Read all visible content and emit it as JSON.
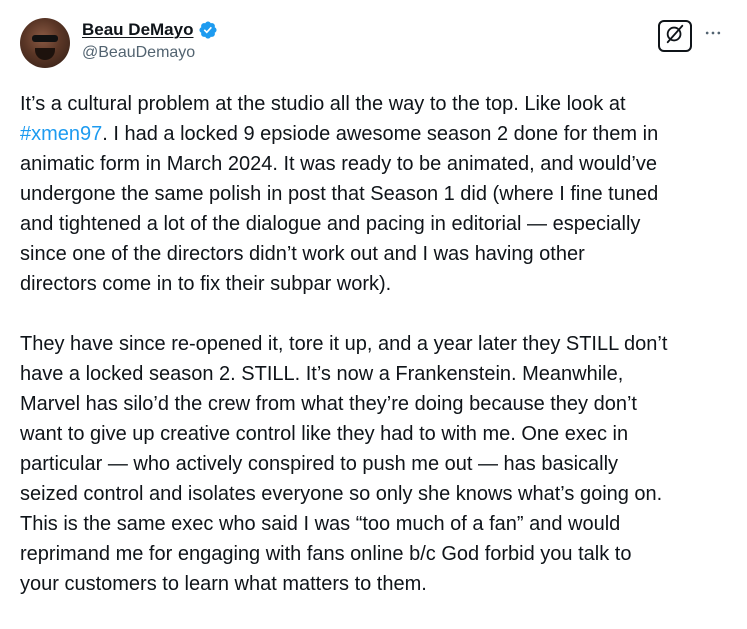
{
  "author": {
    "display_name": "Beau DeMayo",
    "handle": "@BeauDemayo",
    "verified": true,
    "verified_color": "#1d9bf0"
  },
  "actions": {
    "grok_icon": "grok-icon",
    "more_icon": "more-icon"
  },
  "tweet": {
    "hashtag_color": "#1d9bf0",
    "paragraph1": {
      "pre_hashtag": "It’s a cultural problem at the studio all the way to the top. Like look at",
      "hashtag": "#xmen97",
      "lines": [
        ". I had a locked 9 epsiode awesome season 2 done for them in",
        "animatic form in March 2024. It was ready to be animated, and would’ve",
        "undergone the same polish in post that  Season 1 did (where I fine tuned",
        "and tightened a lot of the dialogue and pacing in editorial — especially",
        "since one of the directors didn’t work out and I was having other",
        "directors come in to fix their subpar work)."
      ]
    },
    "paragraph2": {
      "lines": [
        "They have since re-opened it, tore it up, and a year later they STILL don’t",
        "have a locked season 2. STILL. It’s now a Frankenstein. Meanwhile,",
        "Marvel has silo’d the crew from what they’re doing because they don’t",
        "want to give up creative control like they had to with me. One exec in",
        "particular — who actively conspired to push me out — has basically",
        "seized control and isolates everyone so only she knows what’s going on.",
        "This is the same exec who said I was “too much of a fan” and would",
        "reprimand me for engaging with fans online b/c God forbid you talk to",
        "your customers to learn what matters to them."
      ]
    }
  }
}
